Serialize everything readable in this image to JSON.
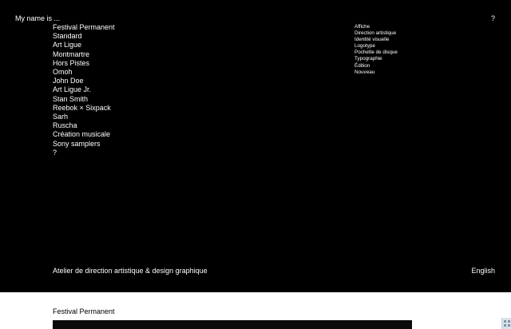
{
  "header": {
    "site_name": "My name is ...",
    "help_link": "?"
  },
  "projects": [
    "Festival Permanent",
    "Standard",
    "Art Ligue",
    "Montmartre",
    "Hors Pistes",
    "Omoh",
    "John Doe",
    "Art Ligue Jr.",
    "Stan Smith",
    "Reebok × Sixpack",
    "Sarh",
    "Ruscha",
    "Création musicale",
    "Sony samplers",
    "?"
  ],
  "categories": [
    "Affiche",
    "Direction artistique",
    "Identité visuelle",
    "Logotype",
    "Pochette de disque",
    "Typographie",
    "Édition",
    "Nouveau"
  ],
  "footer": {
    "tagline": "Atelier de direction artistique & design graphique",
    "language": "English"
  },
  "section": {
    "title": "Festival Permanent"
  },
  "colors": {
    "background_dark": "#000000",
    "text_light": "#ffffff",
    "background_light": "#ffffff"
  },
  "icons": {
    "corner_widget": "grid-icon"
  }
}
